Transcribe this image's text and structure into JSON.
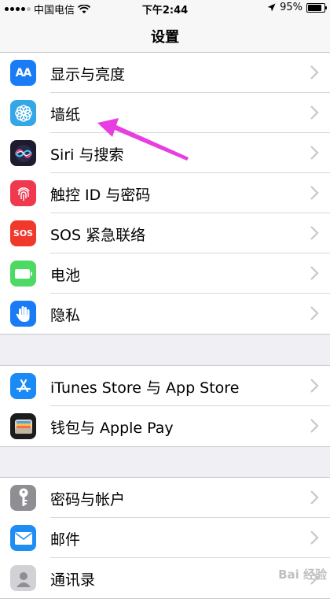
{
  "status_bar": {
    "carrier": "中国电信",
    "time": "下午2:44",
    "battery_percent_label": "95%",
    "battery_level": 0.95
  },
  "nav": {
    "title": "设置"
  },
  "groups": [
    {
      "items": [
        {
          "label": "显示与亮度",
          "icon": "display-brightness-icon",
          "icon_color": "#1a7cf5"
        },
        {
          "label": "墙纸",
          "icon": "wallpaper-flower-icon",
          "icon_color": "#35a6e6"
        },
        {
          "label": "Siri 与搜索",
          "icon": "siri-icon",
          "icon_color": "#1c1c2e"
        },
        {
          "label": "触控 ID 与密码",
          "icon": "fingerprint-icon",
          "icon_color": "#f0384e"
        },
        {
          "label": "SOS 紧急联络",
          "icon": "sos-icon",
          "icon_color": "#f0382b"
        },
        {
          "label": "电池",
          "icon": "battery-icon",
          "icon_color": "#4cd964"
        },
        {
          "label": "隐私",
          "icon": "privacy-hand-icon",
          "icon_color": "#1a7cf5"
        }
      ]
    },
    {
      "items": [
        {
          "label": "iTunes Store 与 App Store",
          "icon": "app-store-icon",
          "icon_color": "#1a8af5"
        },
        {
          "label": "钱包与 Apple Pay",
          "icon": "wallet-icon",
          "icon_color": "#1c1c1c"
        }
      ]
    },
    {
      "items": [
        {
          "label": "密码与帐户",
          "icon": "key-icon",
          "icon_color": "#8e8e93"
        },
        {
          "label": "邮件",
          "icon": "mail-icon",
          "icon_color": "#1e8ef5"
        },
        {
          "label": "通讯录",
          "icon": "contacts-icon",
          "icon_color": "#c7c7cc"
        }
      ]
    }
  ],
  "icons": {
    "display_text": "AA",
    "sos_text": "SOS"
  },
  "annotation_arrow_color": "#e83de0",
  "watermark": "Bai 经验"
}
